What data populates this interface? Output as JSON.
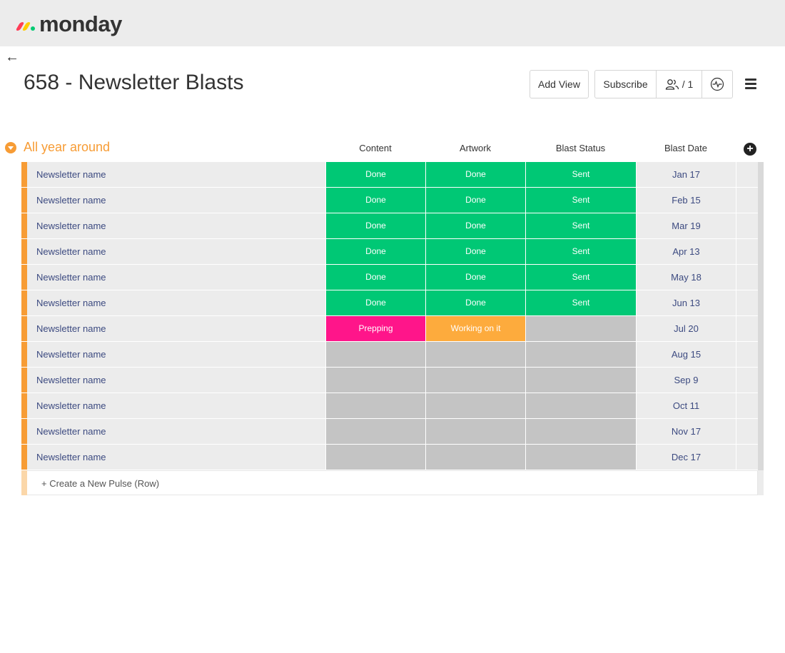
{
  "app": {
    "logo_text": "monday"
  },
  "nav": {
    "back_label": "←"
  },
  "board": {
    "title": "658 - Newsletter Blasts"
  },
  "toolbar": {
    "add_view_label": "Add View",
    "subscribe_label": "Subscribe",
    "people_count": "/ 1"
  },
  "group": {
    "title": "All year around",
    "color": "#f79c35"
  },
  "columns": [
    "Content",
    "Artwork",
    "Blast Status",
    "Blast Date"
  ],
  "status_colors": {
    "Done": "#00c875",
    "Sent": "#00c875",
    "Prepping": "#ff158a",
    "Working on it": "#fdab3d",
    "": "#c4c4c4"
  },
  "rows": [
    {
      "name": "Newsletter name",
      "content": "Done",
      "artwork": "Done",
      "status": "Sent",
      "date": "Jan 17"
    },
    {
      "name": "Newsletter name",
      "content": "Done",
      "artwork": "Done",
      "status": "Sent",
      "date": "Feb 15"
    },
    {
      "name": "Newsletter name",
      "content": "Done",
      "artwork": "Done",
      "status": "Sent",
      "date": "Mar 19"
    },
    {
      "name": "Newsletter name",
      "content": "Done",
      "artwork": "Done",
      "status": "Sent",
      "date": "Apr 13"
    },
    {
      "name": "Newsletter name",
      "content": "Done",
      "artwork": "Done",
      "status": "Sent",
      "date": "May 18"
    },
    {
      "name": "Newsletter name",
      "content": "Done",
      "artwork": "Done",
      "status": "Sent",
      "date": "Jun 13"
    },
    {
      "name": "Newsletter name",
      "content": "Prepping",
      "artwork": "Working on it",
      "status": "",
      "date": "Jul 20"
    },
    {
      "name": "Newsletter name",
      "content": "",
      "artwork": "",
      "status": "",
      "date": "Aug 15"
    },
    {
      "name": "Newsletter name",
      "content": "",
      "artwork": "",
      "status": "",
      "date": "Sep 9"
    },
    {
      "name": "Newsletter name",
      "content": "",
      "artwork": "",
      "status": "",
      "date": "Oct 11"
    },
    {
      "name": "Newsletter name",
      "content": "",
      "artwork": "",
      "status": "",
      "date": "Nov 17"
    },
    {
      "name": "Newsletter name",
      "content": "",
      "artwork": "",
      "status": "",
      "date": "Dec 17"
    }
  ],
  "new_row": {
    "label": "+ Create a New Pulse (Row)"
  }
}
